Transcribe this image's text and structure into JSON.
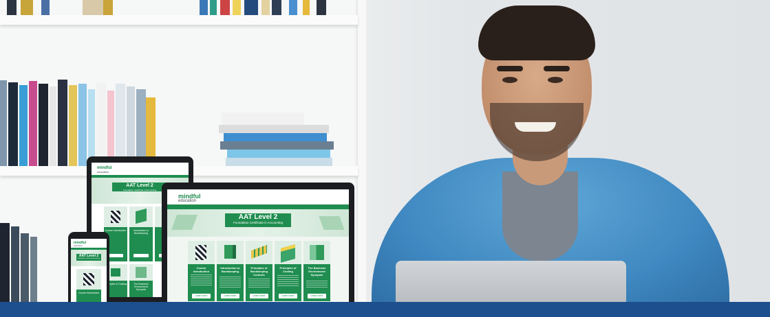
{
  "brand": {
    "logo_line1": "mindful",
    "logo_line2": "education",
    "accent": "#1f8d4f",
    "footer_bar": "#1d4f8e"
  },
  "course": {
    "title": "AAT Level 2",
    "subtitle": "Foundation Certificate in Accounting"
  },
  "cards": [
    {
      "title": "Course Introduction",
      "button": "Learn more",
      "icon": "flag-icon"
    },
    {
      "title": "Introduction to Bookkeeping",
      "button": "Learn more",
      "icon": "cube-icon"
    },
    {
      "title": "Principles of Bookkeeping Controls",
      "button": "Learn more",
      "icon": "ledger-icon"
    },
    {
      "title": "Principles of Costing",
      "button": "Learn more",
      "icon": "calculator-icon"
    },
    {
      "title": "The Business Environment Synopsis",
      "button": "Learn more",
      "icon": "buildings-icon"
    }
  ],
  "tablet_cards": [
    {
      "title": "Course Introduction"
    },
    {
      "title": "Introduction to Bookkeeping"
    },
    {
      "title": "Principles of Costing"
    },
    {
      "title": "The Business Environment Synopsis"
    }
  ],
  "phone_card": {
    "title": "Course Introduction"
  }
}
